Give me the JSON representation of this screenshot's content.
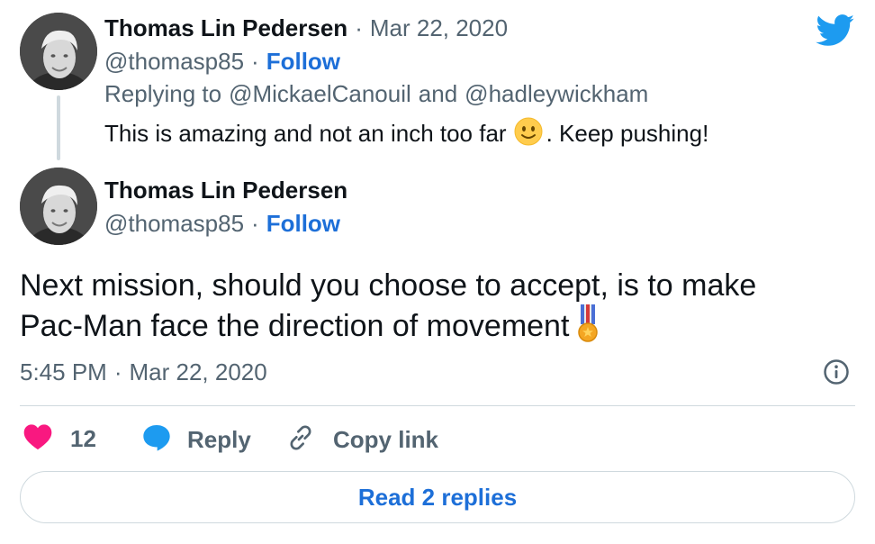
{
  "parent_tweet": {
    "author_name": "Thomas Lin Pedersen",
    "date_sep": "·",
    "date": "Mar 22, 2020",
    "handle": "@thomasp85",
    "follow_sep": "·",
    "follow_label": "Follow",
    "replying_prefix": "Replying to",
    "reply_to_1": "@MickaelCanouil",
    "reply_and": "and",
    "reply_to_2": "@hadleywickham",
    "text_before_emoji": "This is amazing and not an inch too far",
    "emoji": "slightly-smiling-face",
    "text_after_emoji": ". Keep pushing!"
  },
  "main_tweet": {
    "author_name": "Thomas Lin Pedersen",
    "handle": "@thomasp85",
    "follow_sep": "·",
    "follow_label": "Follow",
    "text_line1": "Next mission, should you choose to accept, is to make",
    "text_line2": "Pac-Man face the direction of movement",
    "emoji": "military-medal",
    "time": "5:45 PM",
    "time_sep": "·",
    "date": "Mar 22, 2020"
  },
  "actions": {
    "like_count": "12",
    "reply_label": "Reply",
    "copy_link_label": "Copy link"
  },
  "read_replies_label": "Read 2 replies",
  "colors": {
    "accent": "#1d6fd8",
    "twitter_blue": "#1d9bf0",
    "heart": "#f91880",
    "muted": "#536471",
    "border": "#cfd9de"
  },
  "icons": {
    "brand": "twitter-bird-icon",
    "info": "info-icon",
    "like": "heart-icon",
    "reply": "speech-bubble-icon",
    "copy": "link-icon"
  }
}
